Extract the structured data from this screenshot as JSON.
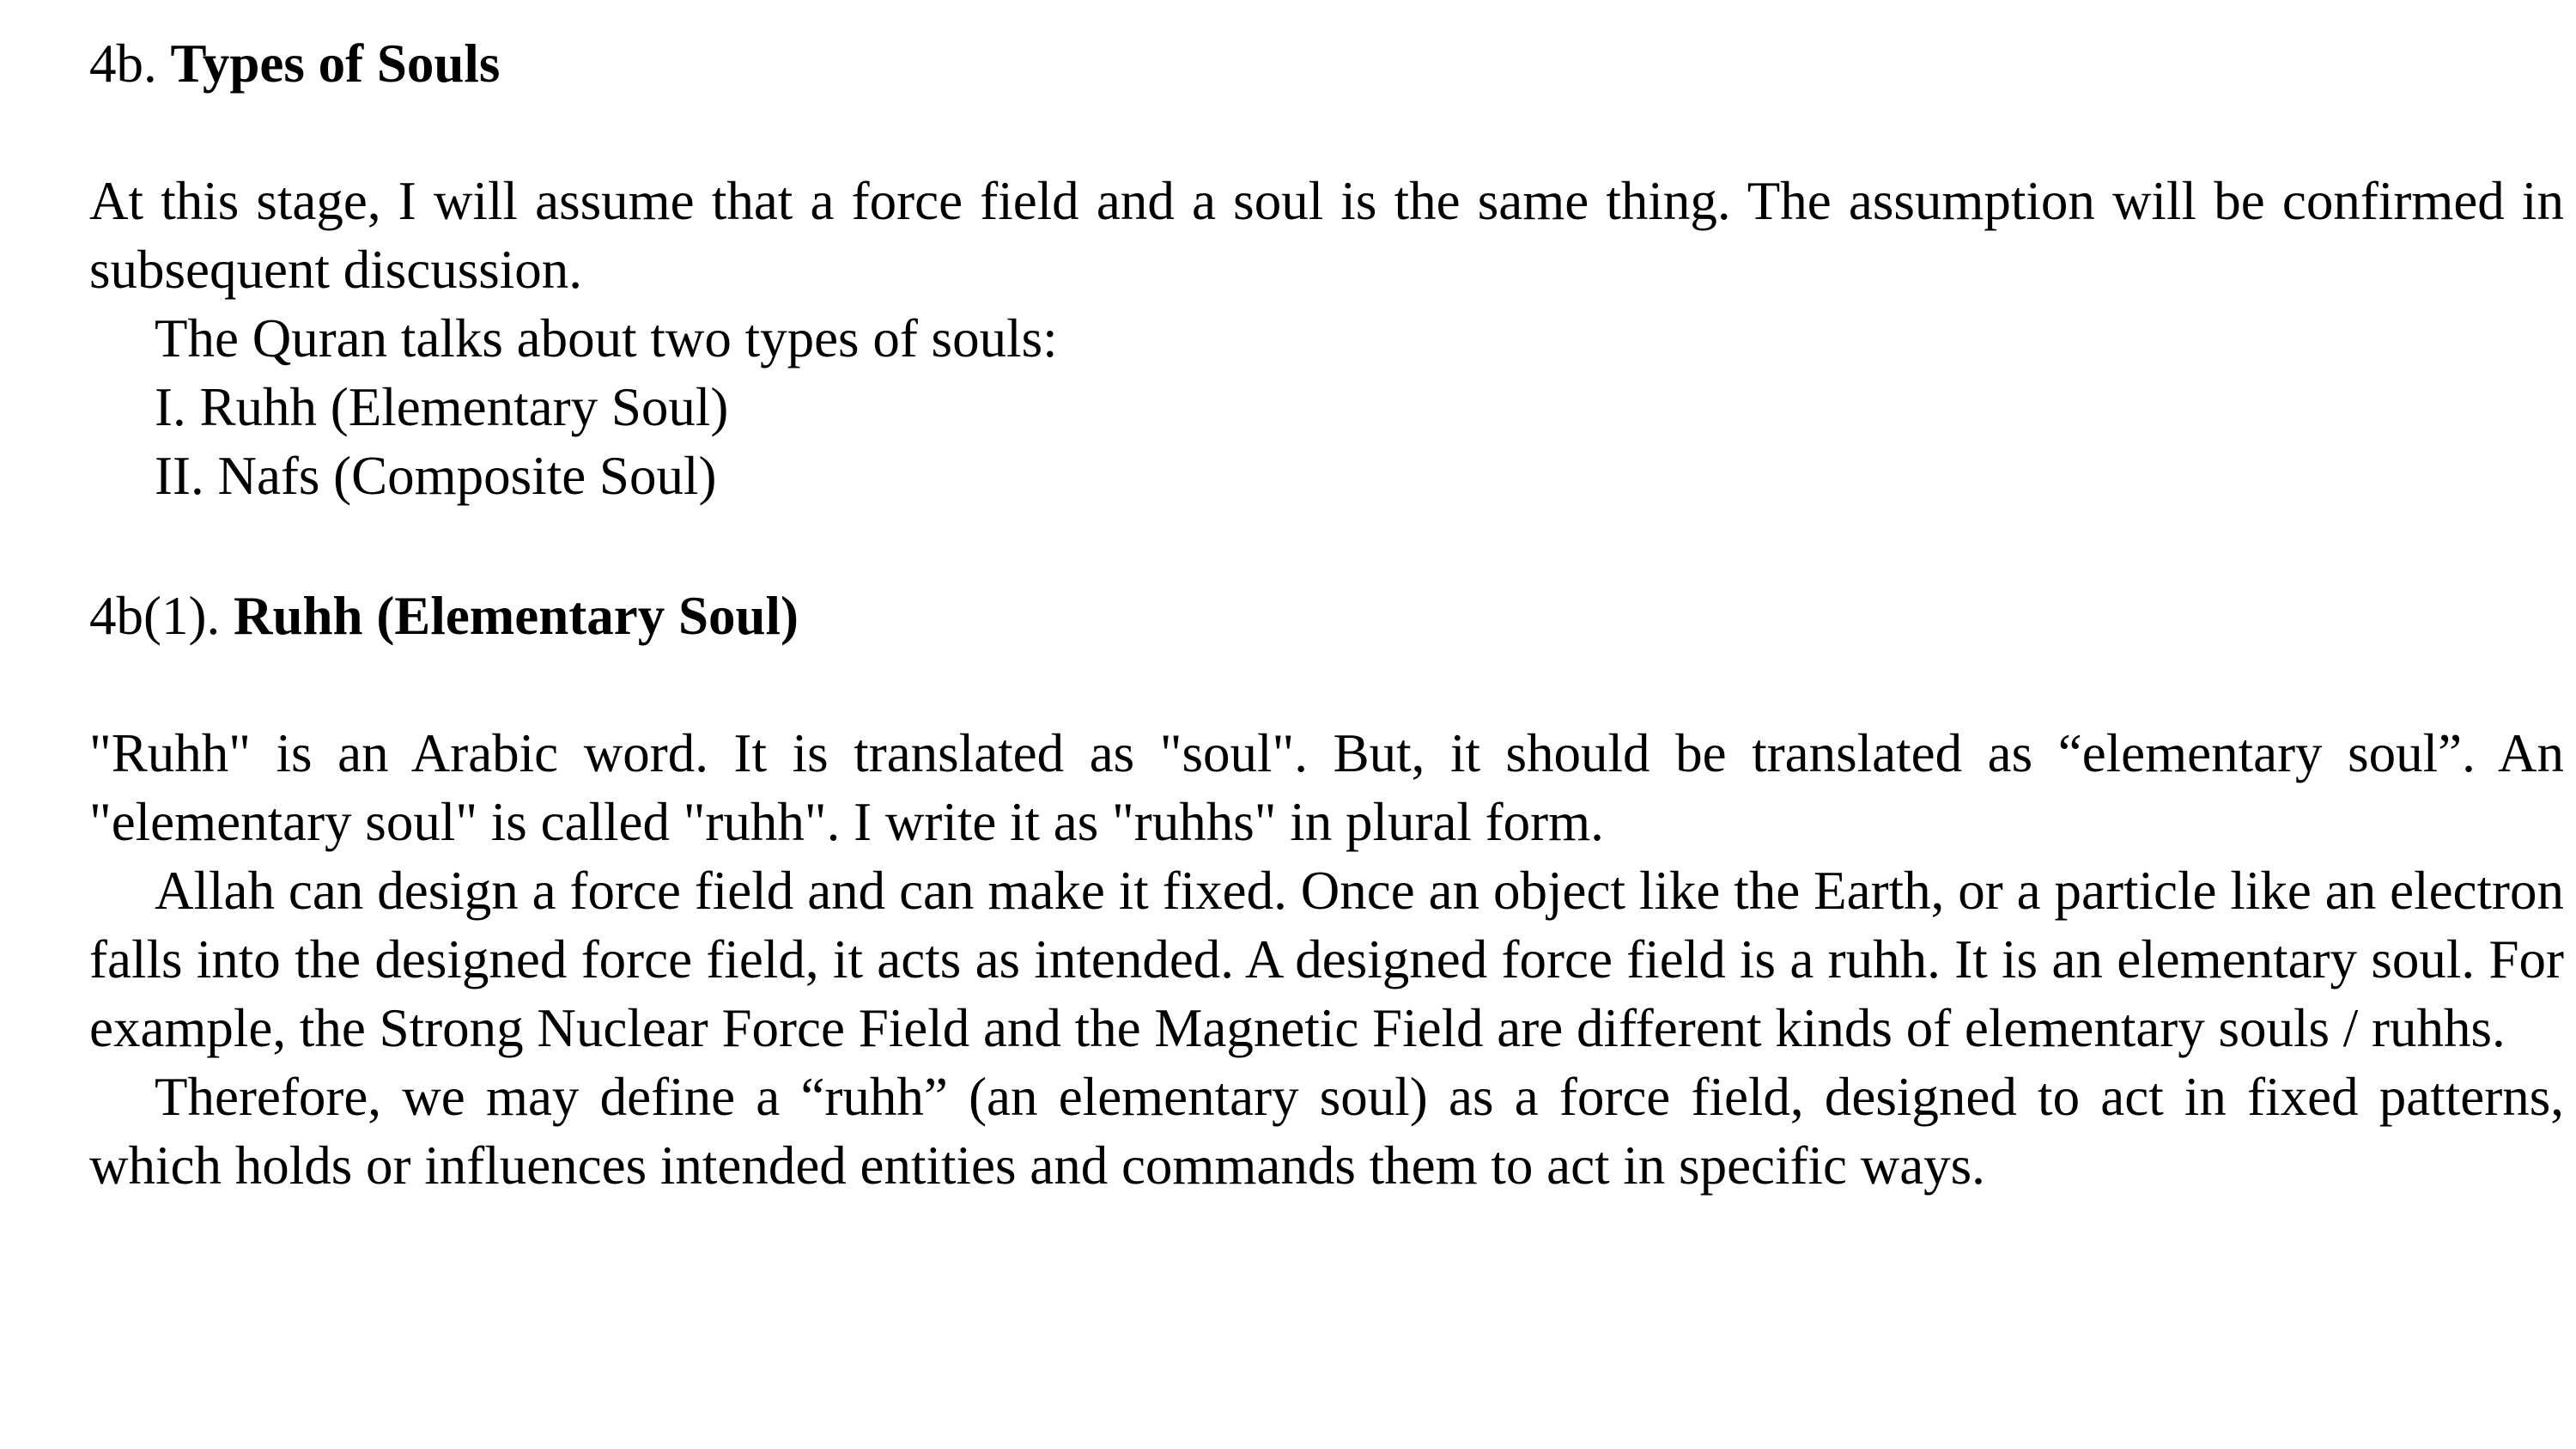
{
  "section_4b": {
    "number": "4b.",
    "title": "Types of Souls",
    "paragraphs": [
      "At this stage, I will assume that a force field and a soul is the same thing. The assumption will be confirmed in subsequent discussion."
    ],
    "intro": "The Quran talks about two types of souls:",
    "list": [
      "I. Ruhh (Elementary Soul)",
      "II. Nafs (Composite Soul)"
    ]
  },
  "section_4b1": {
    "number": "4b(1).",
    "title": "Ruhh (Elementary Soul)",
    "paragraphs": [
      "\"Ruhh\" is an Arabic word. It is translated as \"soul\". But, it should be translated as “elementary soul”. An \"elementary soul\" is called \"ruhh\". I write it as \"ruhhs\" in plural form.",
      "Allah can design a force field and can make it fixed. Once an object like the Earth, or a particle like an electron falls into the designed force field, it acts as intended. A designed force field is a ruhh. It is an elementary soul. For example, the Strong Nuclear Force Field and the Magnetic Field are different kinds of elementary souls / ruhhs.",
      "Therefore, we may define a “ruhh” (an elementary soul) as a force field, designed to act in fixed patterns, which holds or influences intended entities and commands them to act in specific ways."
    ]
  }
}
